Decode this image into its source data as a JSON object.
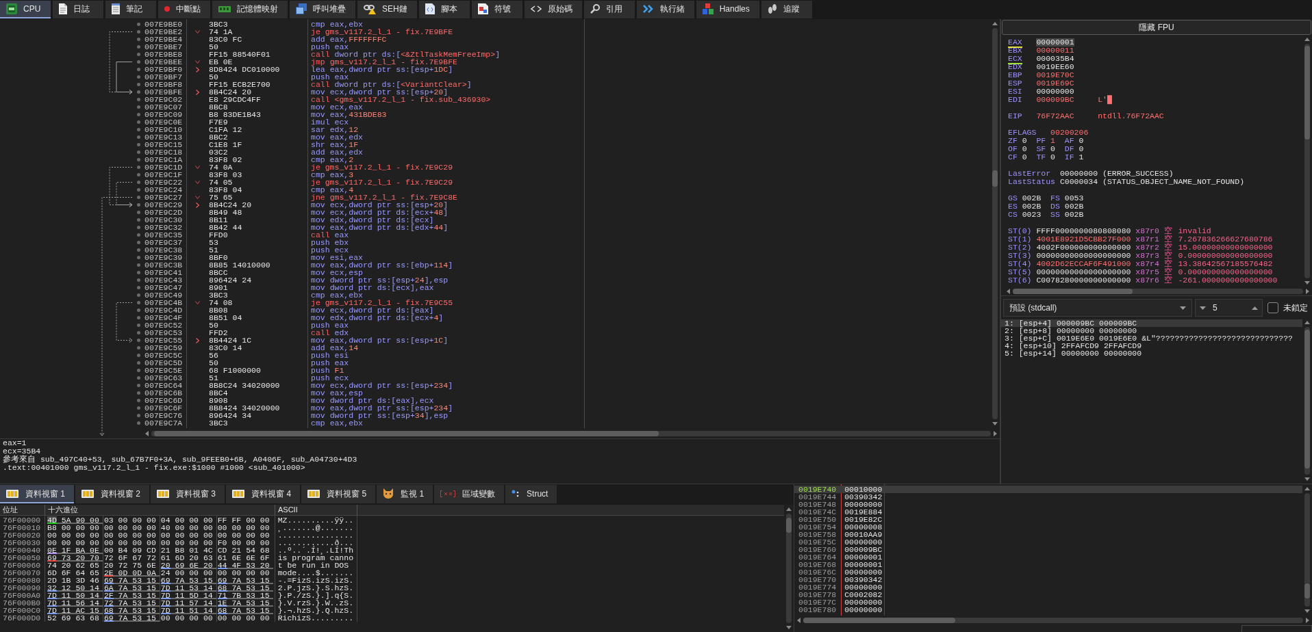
{
  "main_tabs": [
    {
      "label": "CPU",
      "selected": true
    },
    {
      "label": "日誌",
      "selected": false
    },
    {
      "label": "筆記",
      "selected": false
    },
    {
      "label": "中斷點",
      "selected": false
    },
    {
      "label": "記憶體映射",
      "selected": false
    },
    {
      "label": "呼叫堆疊",
      "selected": false
    },
    {
      "label": "SEH鏈",
      "selected": false
    },
    {
      "label": "腳本",
      "selected": false
    },
    {
      "label": "符號",
      "selected": false
    },
    {
      "label": "原始碼",
      "selected": false
    },
    {
      "label": "引用",
      "selected": false
    },
    {
      "label": "執行緒",
      "selected": false
    },
    {
      "label": "Handles",
      "selected": false
    },
    {
      "label": "追蹤",
      "selected": false
    }
  ],
  "disassembly": {
    "rows": [
      {
        "address": "007E9BE0",
        "bytes": "3BC3",
        "mnemonic": "cmp",
        "operands": [
          "eax,ebx"
        ],
        "kind": "plain"
      },
      {
        "address": "007E9BE2",
        "bytes": "74 1A",
        "mnemonic": "je",
        "operands": [
          {
            "sym": "gms_v117.2_l_1 - fix.7E9BFE"
          }
        ],
        "kind": "jump"
      },
      {
        "address": "007E9BE4",
        "bytes": "83C0 FC",
        "mnemonic": "add",
        "operands": [
          "eax,",
          {
            "imm": "FFFFFFFC"
          }
        ],
        "kind": "plain"
      },
      {
        "address": "007E9BE7",
        "bytes": "50",
        "mnemonic": "push",
        "operands": [
          "eax"
        ],
        "kind": "plain"
      },
      {
        "address": "007E9BE8",
        "bytes": "FF15 88540F01",
        "mnemonic": "call",
        "operands": [
          "dword ptr ds:[",
          {
            "sym": "<&ZtlTaskMemFreeImp>"
          },
          "]"
        ],
        "kind": "call"
      },
      {
        "address": "007E9BEE",
        "bytes": "EB 0E",
        "mnemonic": "jmp",
        "operands": [
          {
            "sym": "gms_v117.2_l_1 - fix.7E9BFE"
          }
        ],
        "kind": "jump"
      },
      {
        "address": "007E9BF0",
        "bytes": "8D8424 DC010000",
        "mnemonic": "lea",
        "operands": [
          "eax,dword ptr ss:[esp+",
          {
            "imm": "1DC"
          },
          "]"
        ],
        "kind": "target"
      },
      {
        "address": "007E9BF7",
        "bytes": "50",
        "mnemonic": "push",
        "operands": [
          "eax"
        ],
        "kind": "plain"
      },
      {
        "address": "007E9BF8",
        "bytes": "FF15 ECB2E700",
        "mnemonic": "call",
        "operands": [
          "dword ptr ds:[",
          {
            "sym": "<VariantClear>"
          },
          "]"
        ],
        "kind": "call"
      },
      {
        "address": "007E9BFE",
        "bytes": "8B4C24 20",
        "mnemonic": "mov",
        "operands": [
          "ecx,dword ptr ss:[esp+",
          {
            "imm": "20"
          },
          "]"
        ],
        "kind": "target"
      },
      {
        "address": "007E9C02",
        "bytes": "E8 29CDC4FF",
        "mnemonic": "call",
        "operands": [
          {
            "sym": "<gms_v117.2_l_1 - fix.sub_436930>"
          }
        ],
        "kind": "call"
      },
      {
        "address": "007E9C07",
        "bytes": "8BC8",
        "mnemonic": "mov",
        "operands": [
          "ecx,eax"
        ],
        "kind": "plain"
      },
      {
        "address": "007E9C09",
        "bytes": "B8 83DE1B43",
        "mnemonic": "mov",
        "operands": [
          "eax,",
          {
            "imm": "431BDE83"
          }
        ],
        "kind": "plain"
      },
      {
        "address": "007E9C0E",
        "bytes": "F7E9",
        "mnemonic": "imul",
        "operands": [
          "ecx"
        ],
        "kind": "plain"
      },
      {
        "address": "007E9C10",
        "bytes": "C1FA 12",
        "mnemonic": "sar",
        "operands": [
          "edx,",
          {
            "imm": "12"
          }
        ],
        "kind": "plain"
      },
      {
        "address": "007E9C13",
        "bytes": "8BC2",
        "mnemonic": "mov",
        "operands": [
          "eax,edx"
        ],
        "kind": "plain"
      },
      {
        "address": "007E9C15",
        "bytes": "C1E8 1F",
        "mnemonic": "shr",
        "operands": [
          "eax,",
          {
            "imm": "1F"
          }
        ],
        "kind": "plain"
      },
      {
        "address": "007E9C18",
        "bytes": "03C2",
        "mnemonic": "add",
        "operands": [
          "eax,edx"
        ],
        "kind": "plain"
      },
      {
        "address": "007E9C1A",
        "bytes": "83F8 02",
        "mnemonic": "cmp",
        "operands": [
          "eax,",
          {
            "imm": "2"
          }
        ],
        "kind": "plain"
      },
      {
        "address": "007E9C1D",
        "bytes": "74 0A",
        "mnemonic": "je",
        "operands": [
          {
            "sym": "gms_v117.2_l_1 - fix.7E9C29"
          }
        ],
        "kind": "jump"
      },
      {
        "address": "007E9C1F",
        "bytes": "83F8 03",
        "mnemonic": "cmp",
        "operands": [
          "eax,",
          {
            "imm": "3"
          }
        ],
        "kind": "plain"
      },
      {
        "address": "007E9C22",
        "bytes": "74 05",
        "mnemonic": "je",
        "operands": [
          {
            "sym": "gms_v117.2_l_1 - fix.7E9C29"
          }
        ],
        "kind": "jump"
      },
      {
        "address": "007E9C24",
        "bytes": "83F8 04",
        "mnemonic": "cmp",
        "operands": [
          "eax,",
          {
            "imm": "4"
          }
        ],
        "kind": "plain"
      },
      {
        "address": "007E9C27",
        "bytes": "75 65",
        "mnemonic": "jne",
        "operands": [
          {
            "sym": "gms_v117.2_l_1 - fix.7E9C8E"
          }
        ],
        "kind": "jump"
      },
      {
        "address": "007E9C29",
        "bytes": "8B4C24 20",
        "mnemonic": "mov",
        "operands": [
          "ecx,dword ptr ss:[esp+",
          {
            "imm": "20"
          },
          "]"
        ],
        "kind": "target"
      },
      {
        "address": "007E9C2D",
        "bytes": "8B49 48",
        "mnemonic": "mov",
        "operands": [
          "ecx,dword ptr ds:[ecx+",
          {
            "imm": "48"
          },
          "]"
        ],
        "kind": "plain"
      },
      {
        "address": "007E9C30",
        "bytes": "8B11",
        "mnemonic": "mov",
        "operands": [
          "edx,dword ptr ds:[ecx]"
        ],
        "kind": "plain"
      },
      {
        "address": "007E9C32",
        "bytes": "8B42 44",
        "mnemonic": "mov",
        "operands": [
          "eax,dword ptr ds:[edx+",
          {
            "imm": "44"
          },
          "]"
        ],
        "kind": "plain"
      },
      {
        "address": "007E9C35",
        "bytes": "FFD0",
        "mnemonic": "call",
        "operands": [
          "eax"
        ],
        "kind": "call"
      },
      {
        "address": "007E9C37",
        "bytes": "53",
        "mnemonic": "push",
        "operands": [
          "ebx"
        ],
        "kind": "plain"
      },
      {
        "address": "007E9C38",
        "bytes": "51",
        "mnemonic": "push",
        "operands": [
          "ecx"
        ],
        "kind": "plain"
      },
      {
        "address": "007E9C39",
        "bytes": "8BF0",
        "mnemonic": "mov",
        "operands": [
          "esi,eax"
        ],
        "kind": "plain"
      },
      {
        "address": "007E9C3B",
        "bytes": "8B85 14010000",
        "mnemonic": "mov",
        "operands": [
          "eax,dword ptr ss:[ebp+",
          {
            "imm": "114"
          },
          "]"
        ],
        "kind": "plain"
      },
      {
        "address": "007E9C41",
        "bytes": "8BCC",
        "mnemonic": "mov",
        "operands": [
          "ecx,esp"
        ],
        "kind": "plain"
      },
      {
        "address": "007E9C43",
        "bytes": "896424 24",
        "mnemonic": "mov",
        "operands": [
          "dword ptr ss:[esp+",
          {
            "imm": "24"
          },
          "],esp"
        ],
        "kind": "plain"
      },
      {
        "address": "007E9C47",
        "bytes": "8901",
        "mnemonic": "mov",
        "operands": [
          "dword ptr ds:[ecx],eax"
        ],
        "kind": "plain"
      },
      {
        "address": "007E9C49",
        "bytes": "3BC3",
        "mnemonic": "cmp",
        "operands": [
          "eax,ebx"
        ],
        "kind": "plain"
      },
      {
        "address": "007E9C4B",
        "bytes": "74 08",
        "mnemonic": "je",
        "operands": [
          {
            "sym": "gms_v117.2_l_1 - fix.7E9C55"
          }
        ],
        "kind": "jump"
      },
      {
        "address": "007E9C4D",
        "bytes": "8B08",
        "mnemonic": "mov",
        "operands": [
          "ecx,dword ptr ds:[eax]"
        ],
        "kind": "plain"
      },
      {
        "address": "007E9C4F",
        "bytes": "8B51 04",
        "mnemonic": "mov",
        "operands": [
          "edx,dword ptr ds:[ecx+",
          {
            "imm": "4"
          },
          "]"
        ],
        "kind": "plain"
      },
      {
        "address": "007E9C52",
        "bytes": "50",
        "mnemonic": "push",
        "operands": [
          "eax"
        ],
        "kind": "plain"
      },
      {
        "address": "007E9C53",
        "bytes": "FFD2",
        "mnemonic": "call",
        "operands": [
          "edx"
        ],
        "kind": "call"
      },
      {
        "address": "007E9C55",
        "bytes": "8B4424 1C",
        "mnemonic": "mov",
        "operands": [
          "eax,dword ptr ss:[esp+",
          {
            "imm": "1C"
          },
          "]"
        ],
        "kind": "target"
      },
      {
        "address": "007E9C59",
        "bytes": "83C0 14",
        "mnemonic": "add",
        "operands": [
          "eax,",
          {
            "imm": "14"
          }
        ],
        "kind": "plain"
      },
      {
        "address": "007E9C5C",
        "bytes": "56",
        "mnemonic": "push",
        "operands": [
          "esi"
        ],
        "kind": "plain"
      },
      {
        "address": "007E9C5D",
        "bytes": "50",
        "mnemonic": "push",
        "operands": [
          "eax"
        ],
        "kind": "plain"
      },
      {
        "address": "007E9C5E",
        "bytes": "68 F1000000",
        "mnemonic": "push",
        "operands": [
          {
            "imm": "F1"
          }
        ],
        "kind": "plain"
      },
      {
        "address": "007E9C63",
        "bytes": "51",
        "mnemonic": "push",
        "operands": [
          "ecx"
        ],
        "kind": "plain"
      },
      {
        "address": "007E9C64",
        "bytes": "8B8C24 34020000",
        "mnemonic": "mov",
        "operands": [
          "ecx,dword ptr ss:[esp+",
          {
            "imm": "234"
          },
          "]"
        ],
        "kind": "plain"
      },
      {
        "address": "007E9C6B",
        "bytes": "8BC4",
        "mnemonic": "mov",
        "operands": [
          "eax,esp"
        ],
        "kind": "plain"
      },
      {
        "address": "007E9C6D",
        "bytes": "8908",
        "mnemonic": "mov",
        "operands": [
          "dword ptr ds:[eax],ecx"
        ],
        "kind": "plain"
      },
      {
        "address": "007E9C6F",
        "bytes": "8B8424 34020000",
        "mnemonic": "mov",
        "operands": [
          "eax,dword ptr ss:[esp+",
          {
            "imm": "234"
          },
          "]"
        ],
        "kind": "plain"
      },
      {
        "address": "007E9C76",
        "bytes": "896424 34",
        "mnemonic": "mov",
        "operands": [
          "dword ptr ss:[esp+",
          {
            "imm": "34"
          },
          "],esp"
        ],
        "kind": "plain"
      },
      {
        "address": "007E9C7A",
        "bytes": "3BC3",
        "mnemonic": "cmp",
        "operands": [
          "eax,ebx"
        ],
        "kind": "plain"
      }
    ]
  },
  "info_panel": {
    "lines": [
      "eax=1",
      "ecx=35B4",
      "參考來自 sub_497C40+53, sub_67B7F0+3A, sub_9FEEB0+6B, A0406F, sub_A04730+4D3",
      ".text:00401000 gms_v117.2_l_1 - fix.exe:$1000 #1000 <sub_401000>"
    ]
  },
  "registers": {
    "toggle": "隱藏 FPU",
    "general": [
      {
        "name": "EAX",
        "value": "00000001",
        "changed": false,
        "selected": true,
        "color": "#e3e040"
      },
      {
        "name": "EBX",
        "value": "00000011",
        "changed": true,
        "selected": false
      },
      {
        "name": "ECX",
        "value": "000035B4",
        "changed": false,
        "selected": false,
        "color": "#a6e03a"
      },
      {
        "name": "EDX",
        "value": "0019EE60",
        "changed": false,
        "selected": false
      },
      {
        "name": "EBP",
        "value": "0019E70C",
        "changed": true,
        "selected": false
      },
      {
        "name": "ESP",
        "value": "0019E69C",
        "changed": true,
        "selected": false
      },
      {
        "name": "ESI",
        "value": "00000000",
        "changed": false,
        "selected": false
      },
      {
        "name": "EDI",
        "value": "000009BC",
        "changed": true,
        "selected": false,
        "comment": "L'█"
      }
    ],
    "eip": {
      "name": "EIP",
      "value": "76F72AAC",
      "changed": true,
      "comment": "ntdll.76F72AAC"
    },
    "eflags": {
      "name": "EFLAGS",
      "value": "00200206",
      "changed": true
    },
    "flags": [
      [
        {
          "name": "ZF",
          "value": "0",
          "changed": false
        },
        {
          "name": "PF",
          "value": "1",
          "changed": true
        },
        {
          "name": "AF",
          "value": "0",
          "changed": false
        }
      ],
      [
        {
          "name": "OF",
          "value": "0",
          "changed": false
        },
        {
          "name": "SF",
          "value": "0",
          "changed": false
        },
        {
          "name": "DF",
          "value": "0",
          "changed": false
        }
      ],
      [
        {
          "name": "CF",
          "value": "0",
          "changed": false
        },
        {
          "name": "TF",
          "value": "0",
          "changed": false
        },
        {
          "name": "IF",
          "value": "1",
          "changed": false
        }
      ]
    ],
    "last_error": {
      "name": "LastError",
      "value": "00000000",
      "changed": false,
      "comment": "(ERROR_SUCCESS)"
    },
    "last_status": {
      "name": "LastStatus",
      "value": "C0000034",
      "changed": false,
      "comment": "(STATUS_OBJECT_NAME_NOT_FOUND)"
    },
    "segments": [
      [
        {
          "name": "GS",
          "value": "002B",
          "changed": false
        },
        {
          "name": "FS",
          "value": "0053",
          "changed": false
        }
      ],
      [
        {
          "name": "ES",
          "value": "002B",
          "changed": false
        },
        {
          "name": "DS",
          "value": "002B",
          "changed": false
        }
      ],
      [
        {
          "name": "CS",
          "value": "0023",
          "changed": false
        },
        {
          "name": "SS",
          "value": "002B",
          "changed": false
        }
      ]
    ],
    "fpu": [
      {
        "name": "ST(0)",
        "value": "FFFF0000000080808080",
        "changed": false,
        "tag": "x87r0",
        "status": "空",
        "number": "invalid"
      },
      {
        "name": "ST(1)",
        "value": "4001E8921D5CBB27F000",
        "changed": true,
        "tag": "x87r1",
        "status": "空",
        "number": "7.267836266627680786"
      },
      {
        "name": "ST(2)",
        "value": "4002F000000000000000",
        "changed": false,
        "tag": "x87r2",
        "status": "空",
        "number": "15.00000000000000000"
      },
      {
        "name": "ST(3)",
        "value": "00000000000000000000",
        "changed": false,
        "tag": "x87r3",
        "status": "空",
        "number": "0.000000000000000000"
      },
      {
        "name": "ST(4)",
        "value": "4002D62ECCAF6F491000",
        "changed": true,
        "tag": "x87r4",
        "status": "空",
        "number": "13.38642567185576482"
      },
      {
        "name": "ST(5)",
        "value": "00000000000000000000",
        "changed": false,
        "tag": "x87r5",
        "status": "空",
        "number": "0.000000000000000000"
      },
      {
        "name": "ST(6)",
        "value": "C0078280000000000000",
        "changed": false,
        "tag": "x87r6",
        "status": "空",
        "number": "-261.0000000000000000"
      }
    ]
  },
  "arguments": {
    "convention": "預設 (stdcall)",
    "count": "5",
    "lock_label": "未鎖定",
    "locked": false,
    "rows": [
      {
        "text": "1: [esp+4] 000009BC 000009BC",
        "selected": true
      },
      {
        "text": "2: [esp+8] 00000000 00000000",
        "selected": false
      },
      {
        "text": "3: [esp+C] 0019E6E0 0019E6E0 &L\"?????????????????????????????",
        "selected": false
      },
      {
        "text": "4: [esp+10] 2FFAFCD9 2FFAFCD9",
        "selected": false
      },
      {
        "text": "5: [esp+14] 00000000 00000000",
        "selected": false
      }
    ]
  },
  "dump_tabs": [
    {
      "label": "資料視窗 1",
      "selected": true
    },
    {
      "label": "資料視窗 2",
      "selected": false
    },
    {
      "label": "資料視窗 3",
      "selected": false
    },
    {
      "label": "資料視窗 4",
      "selected": false
    },
    {
      "label": "資料視窗 5",
      "selected": false
    },
    {
      "label": "監視 1",
      "selected": false
    },
    {
      "label": "區域變數",
      "selected": false
    },
    {
      "label": "Struct",
      "selected": false
    }
  ],
  "dump": {
    "columns": [
      "位址",
      "十六進位",
      "ASCII"
    ],
    "rows": [
      {
        "address": "76F00000",
        "groups": [
          {
            "hex": "4D 5A 90 00",
            "selected": true,
            "color": "#1ec81e"
          },
          {
            "hex": "03 00 00 00",
            "selected": false
          },
          {
            "hex": "04 00 00 00",
            "selected": false
          },
          {
            "hex": "FF FF 00 00",
            "selected": false
          }
        ],
        "ascii": "MZ..........ÿÿ.."
      },
      {
        "address": "76F00010",
        "groups": [
          {
            "hex": "B8 00 00 00",
            "selected": false
          },
          {
            "hex": "00 00 00 00",
            "selected": false
          },
          {
            "hex": "40 00 00 00",
            "selected": false
          },
          {
            "hex": "00 00 00 00",
            "selected": false
          }
        ],
        "ascii": "¸.......@......."
      },
      {
        "address": "76F00020",
        "groups": [
          {
            "hex": "00 00 00 00",
            "selected": false
          },
          {
            "hex": "00 00 00 00",
            "selected": false
          },
          {
            "hex": "00 00 00 00",
            "selected": false
          },
          {
            "hex": "00 00 00 00",
            "selected": false
          }
        ],
        "ascii": "................"
      },
      {
        "address": "76F00030",
        "groups": [
          {
            "hex": "00 00 00 00",
            "selected": false
          },
          {
            "hex": "00 00 00 00",
            "selected": false
          },
          {
            "hex": "00 00 00 00",
            "selected": false
          },
          {
            "hex": "F0 00 00 00",
            "selected": false
          }
        ],
        "ascii": "............ð..."
      },
      {
        "address": "76F00040",
        "groups": [
          {
            "hex": "0E 1F BA 0E",
            "selected": false,
            "color": "#b094ec"
          },
          {
            "hex": "00 B4 09 CD",
            "selected": false
          },
          {
            "hex": "21 B8 01 4C",
            "selected": false
          },
          {
            "hex": "CD 21 54 68",
            "selected": false
          }
        ],
        "ascii": "..º..´.Í!¸.LÍ!Th"
      },
      {
        "address": "76F00050",
        "groups": [
          {
            "hex": "69 73 20 70",
            "selected": false,
            "color": "#e0443c"
          },
          {
            "hex": "72 6F 67 72",
            "selected": false
          },
          {
            "hex": "61 6D 20 63",
            "selected": false
          },
          {
            "hex": "61 6E 6E 6F",
            "selected": false
          }
        ],
        "ascii": "is program canno"
      },
      {
        "address": "76F00060",
        "groups": [
          {
            "hex": "74 20 62 65",
            "selected": false
          },
          {
            "hex": "20 72 75 6E",
            "selected": false
          },
          {
            "hex": "20 69 6E 20",
            "selected": false,
            "color": "#7d9cf0"
          },
          {
            "hex": "44 4F 53 20",
            "selected": false,
            "color": "#7d9cf0"
          }
        ],
        "ascii": "t be run in DOS"
      },
      {
        "address": "76F00070",
        "groups": [
          {
            "hex": "6D 6F 64 65",
            "selected": false
          },
          {
            "hex": "2E 0D 0D 0A",
            "selected": false,
            "color": "#e0443c"
          },
          {
            "hex": "24 00 00 00",
            "selected": false
          },
          {
            "hex": "00 00 00 00",
            "selected": false
          }
        ],
        "ascii": "mode....$......."
      },
      {
        "address": "76F00080",
        "groups": [
          {
            "hex": "2D 1B 3D 46",
            "selected": false
          },
          {
            "hex": "69 7A 53 15",
            "selected": false,
            "color": "#7d9cf0"
          },
          {
            "hex": "69 7A 53 15",
            "selected": false,
            "color": "#7d9cf0"
          },
          {
            "hex": "69 7A 53 15",
            "selected": false,
            "color": "#7d9cf0"
          }
        ],
        "ascii": "-.=FizS.izS.izS."
      },
      {
        "address": "76F00090",
        "groups": [
          {
            "hex": "32 12 50 14",
            "selected": false,
            "color": "#7d9cf0"
          },
          {
            "hex": "6A 7A 53 15",
            "selected": false,
            "color": "#7d9cf0"
          },
          {
            "hex": "7D 11 53 14",
            "selected": false,
            "color": "#7d9cf0"
          },
          {
            "hex": "68 7A 53 15",
            "selected": false,
            "color": "#7d9cf0"
          }
        ],
        "ascii": "2.P.jzS.}.S.hzS."
      },
      {
        "address": "76F000A0",
        "groups": [
          {
            "hex": "7D 11 50 14",
            "selected": false,
            "color": "#7d9cf0"
          },
          {
            "hex": "2F 7A 53 15",
            "selected": false,
            "color": "#7d9cf0"
          },
          {
            "hex": "7D 11 5D 14",
            "selected": false,
            "color": "#7d9cf0"
          },
          {
            "hex": "71 7B 53 15",
            "selected": false,
            "color": "#7d9cf0"
          }
        ],
        "ascii": "}.P./zS.}.].q{S."
      },
      {
        "address": "76F000B0",
        "groups": [
          {
            "hex": "7D 11 56 14",
            "selected": false,
            "color": "#7d9cf0"
          },
          {
            "hex": "72 7A 53 15",
            "selected": false,
            "color": "#7d9cf0"
          },
          {
            "hex": "7D 11 57 14",
            "selected": false,
            "color": "#7d9cf0"
          },
          {
            "hex": "1E 7A 53 15",
            "selected": false,
            "color": "#7d9cf0"
          }
        ],
        "ascii": "}.V.rzS.}.W..zS."
      },
      {
        "address": "76F000C0",
        "groups": [
          {
            "hex": "7D 11 AC 15",
            "selected": false,
            "color": "#7d9cf0"
          },
          {
            "hex": "68 7A 53 15",
            "selected": false,
            "color": "#7d9cf0"
          },
          {
            "hex": "7D 11 51 14",
            "selected": false,
            "color": "#7d9cf0"
          },
          {
            "hex": "68 7A 53 15",
            "selected": false,
            "color": "#7d9cf0"
          }
        ],
        "ascii": "}.¬.hzS.}.Q.hzS."
      },
      {
        "address": "76F000D0",
        "groups": [
          {
            "hex": "52 69 63 68",
            "selected": false
          },
          {
            "hex": "69 7A 53 15",
            "selected": false,
            "color": "#7d9cf0"
          },
          {
            "hex": "00 00 00 00",
            "selected": false
          },
          {
            "hex": "00 00 00 00",
            "selected": false
          }
        ],
        "ascii": "RichizS........."
      }
    ]
  },
  "stack": {
    "rows": [
      {
        "address": "0019E740",
        "value": "00010000",
        "selected": true
      },
      {
        "address": "0019E744",
        "value": "00390342",
        "selected": false
      },
      {
        "address": "0019E748",
        "value": "00000000",
        "selected": false
      },
      {
        "address": "0019E74C",
        "value": "0019E884",
        "selected": false
      },
      {
        "address": "0019E750",
        "value": "0019E82C",
        "selected": false
      },
      {
        "address": "0019E754",
        "value": "00000008",
        "selected": false
      },
      {
        "address": "0019E758",
        "value": "00010AA9",
        "selected": false
      },
      {
        "address": "0019E75C",
        "value": "00000000",
        "selected": false
      },
      {
        "address": "0019E760",
        "value": "000009BC",
        "selected": false
      },
      {
        "address": "0019E764",
        "value": "00000001",
        "selected": false
      },
      {
        "address": "0019E768",
        "value": "00000001",
        "selected": false
      },
      {
        "address": "0019E76C",
        "value": "00000000",
        "selected": false
      },
      {
        "address": "0019E770",
        "value": "00390342",
        "selected": false
      },
      {
        "address": "0019E774",
        "value": "00000000",
        "selected": false
      },
      {
        "address": "0019E778",
        "value": "C0002082",
        "selected": false
      },
      {
        "address": "0019E77C",
        "value": "00000000",
        "selected": false
      },
      {
        "address": "0019E780",
        "value": "00000000",
        "selected": false
      }
    ]
  }
}
